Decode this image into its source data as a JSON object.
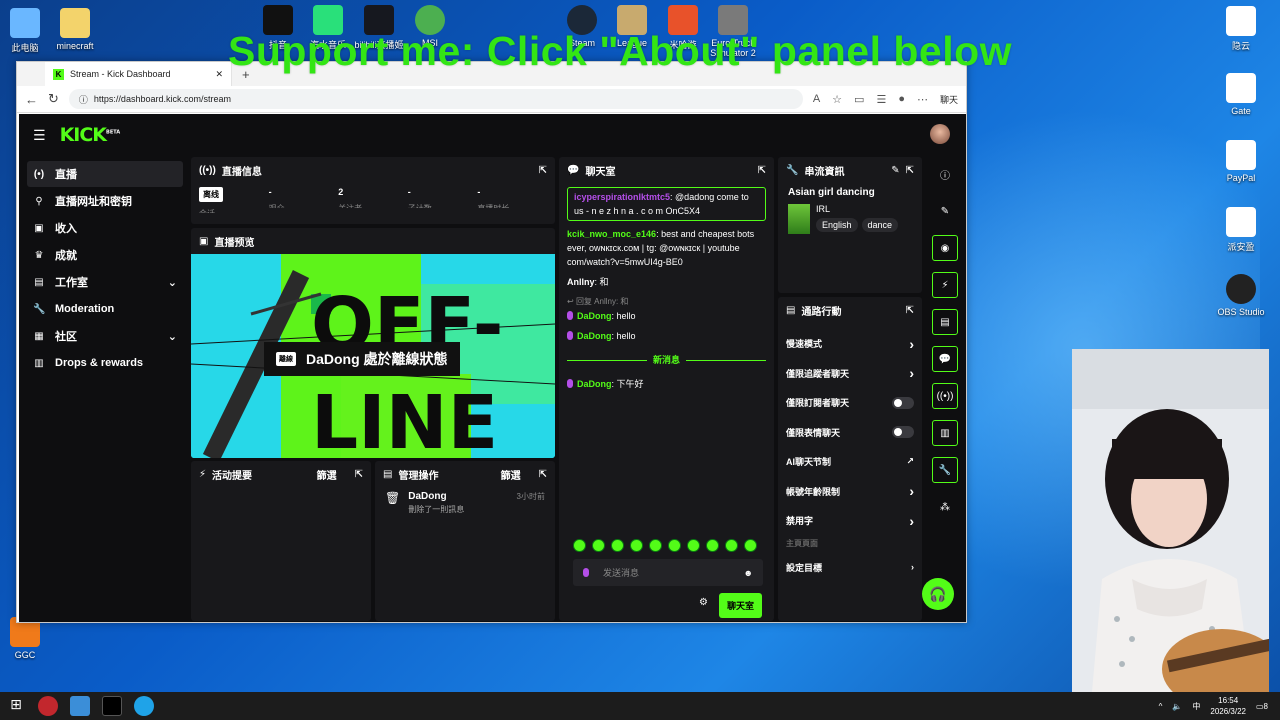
{
  "overlay_text": "Support me: Click \"About\" panel below",
  "desktop_icons_left": [
    "此电脑",
    "minecraft"
  ],
  "desktop_icons_top": [
    "抖音",
    "汽水音乐",
    "bilibili直播姬",
    "MSI",
    "Steam",
    "League",
    "米哈游",
    "Euro Truck Simulator 2"
  ],
  "desktop_icons_right": [
    "隐云",
    "Gate",
    "PayPal",
    "派安盈",
    "OBS Studio"
  ],
  "desktop_icon_bottom_left": "GGC",
  "browser": {
    "tab_title": "Stream - Kick Dashboard",
    "new_tab": "+",
    "url": "https://dashboard.kick.com/stream",
    "chat_button": "聊天"
  },
  "kick": {
    "logo": "KICK",
    "logo_beta": "BETA",
    "sidebar": [
      {
        "icon": "(•)",
        "label": "直播",
        "active": true,
        "chevron": false
      },
      {
        "icon": "⚲",
        "label": "直播网址和密钥",
        "active": false,
        "chevron": false
      },
      {
        "icon": "▣",
        "label": "收入",
        "active": false,
        "chevron": false
      },
      {
        "icon": "♛",
        "label": "成就",
        "active": false,
        "chevron": false
      },
      {
        "icon": "▤",
        "label": "工作室",
        "active": false,
        "chevron": true
      },
      {
        "icon": "🔧",
        "label": "Moderation",
        "active": false,
        "chevron": false
      },
      {
        "icon": "▦",
        "label": "社区",
        "active": false,
        "chevron": true
      },
      {
        "icon": "▥",
        "label": "Drops & rewards",
        "active": false,
        "chevron": false
      }
    ],
    "stream_info": {
      "title": "直播信息",
      "stats": [
        {
          "value": "离线",
          "label": "会话",
          "badge": true
        },
        {
          "value": "-",
          "label": "观众",
          "badge": false
        },
        {
          "value": "2",
          "label": "关注者",
          "badge": false
        },
        {
          "value": "-",
          "label": "子计数",
          "badge": false
        },
        {
          "value": "-",
          "label": "直播时长",
          "badge": false
        }
      ]
    },
    "preview": {
      "title": "直播预览",
      "offline_big": "OFF-LINE",
      "badge": "離線",
      "status": "DaDong 處於離線狀態"
    },
    "activity": {
      "title": "活动提要",
      "filter": "篩選"
    },
    "mod_actions": {
      "title": "管理操作",
      "filter": "篩選",
      "user": "DaDong",
      "action": "刪除了一則訊息",
      "time": "3小时前"
    },
    "chat": {
      "title": "聊天室",
      "messages": [
        {
          "user": "icyperspirationlktmtc5",
          "text": ": @dadong come to us - n e z h n a . c o m OnC5X4",
          "user_color": "#b44fe8",
          "highlight": true
        },
        {
          "user": "kcik_nwo_moc_e146",
          "text": ": best and cheapest bots ever, ᴏᴡɴкɪᴄк.ᴄᴏᴍ | tg: @ᴏᴡɴкɪᴄк | youtube com/watch?v=5mwUI4g-BE0",
          "user_color": "#53fc18",
          "highlight": false
        },
        {
          "user": "Anllny",
          "text": ": 和",
          "user_color": "#ffffff",
          "highlight": false
        }
      ],
      "reply_to": "回复 Anllny: 和",
      "replies": [
        {
          "user": "DaDong",
          "text": ": hello"
        },
        {
          "user": "DaDong",
          "text": ": hello"
        }
      ],
      "new_messages": "新消息",
      "after_divider": {
        "user": "DaDong",
        "text": ": 下午好"
      },
      "placeholder": "发送消息",
      "send_button": "聊天室"
    },
    "stream_details": {
      "title": "串流資訊",
      "stream_title": "Asian girl dancing",
      "category": "IRL",
      "tags": [
        "English",
        "dance"
      ]
    },
    "quick_actions": {
      "title": "通路行動",
      "rows": [
        {
          "label": "慢速模式",
          "control": "chevron"
        },
        {
          "label": "僅限追蹤者聊天",
          "control": "chevron"
        },
        {
          "label": "僅限訂閱者聊天",
          "control": "toggle"
        },
        {
          "label": "僅限表情聊天",
          "control": "toggle"
        },
        {
          "label": "AI聊天节制",
          "control": "external"
        },
        {
          "label": "帳號年齡限制",
          "control": "chevron"
        },
        {
          "label": "禁用字",
          "control": "chevron"
        }
      ],
      "section": "主頁頁面",
      "last_row": "設定目標"
    },
    "rail_icons": [
      "info-icon",
      "edit-icon",
      "camera-icon",
      "bolt-icon",
      "note-icon",
      "chat-bubble-icon",
      "broadcast-icon",
      "layout-icon",
      "wrench-icon",
      "dots-icon"
    ]
  },
  "taskbar": {
    "time": "16:54",
    "date": "2026/3/22",
    "ime": "中",
    "notif": "8"
  }
}
